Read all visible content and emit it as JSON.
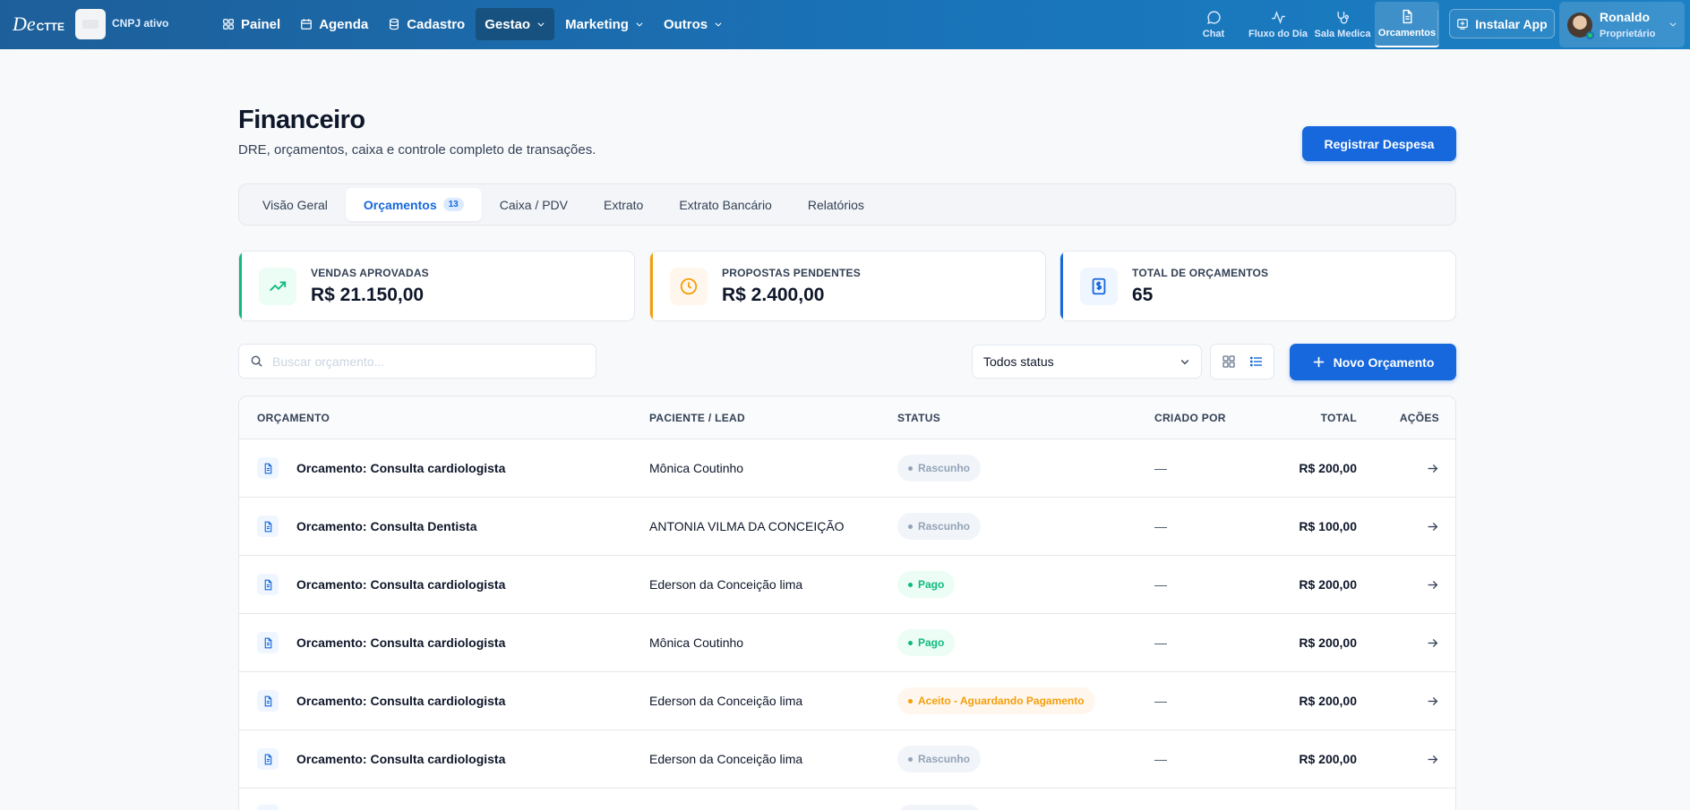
{
  "topbar": {
    "logo_main": "De",
    "logo_small": "CTTE",
    "cnpj_label": "CNPJ ativo",
    "nav": [
      {
        "label": "Painel",
        "icon": "grid-icon"
      },
      {
        "label": "Agenda",
        "icon": "calendar-icon"
      },
      {
        "label": "Cadastro",
        "icon": "database-icon"
      },
      {
        "label": "Gestao",
        "icon": "chevron-down-icon"
      },
      {
        "label": "Marketing",
        "icon": "chevron-down-icon"
      },
      {
        "label": "Outros",
        "icon": "chevron-down-icon"
      }
    ],
    "quick": [
      {
        "label": "Chat",
        "icon": "chat-icon"
      },
      {
        "label": "Fluxo do Dia",
        "icon": "activity-icon"
      },
      {
        "label": "Sala Medica",
        "icon": "stethoscope-icon"
      },
      {
        "label": "Orcamentos",
        "icon": "document-icon"
      }
    ],
    "install_label": "Instalar App",
    "user": {
      "name": "Ronaldo",
      "role": "Proprietário"
    }
  },
  "page": {
    "title": "Financeiro",
    "subtitle": "DRE, orçamentos, caixa e controle completo de transações.",
    "register_button": "Registrar Despesa"
  },
  "tabs": [
    {
      "label": "Visão Geral"
    },
    {
      "label": "Orçamentos",
      "count": "13"
    },
    {
      "label": "Caixa / PDV"
    },
    {
      "label": "Extrato"
    },
    {
      "label": "Extrato Bancário"
    },
    {
      "label": "Relatórios"
    }
  ],
  "stats": [
    {
      "label": "VENDAS APROVADAS",
      "value": "R$ 21.150,00",
      "color": "#10b981"
    },
    {
      "label": "PROPOSTAS PENDENTES",
      "value": "R$ 2.400,00",
      "color": "#f59e0b"
    },
    {
      "label": "TOTAL DE ORÇAMENTOS",
      "value": "65",
      "color": "#1668dc"
    }
  ],
  "toolbar": {
    "search_placeholder": "Buscar orçamento...",
    "status_selected": "Todos status",
    "new_button": "Novo Orçamento"
  },
  "table": {
    "headers": {
      "budget": "ORÇAMENTO",
      "patient": "PACIENTE / LEAD",
      "status": "STATUS",
      "created_by": "CRIADO POR",
      "total": "TOTAL",
      "actions": "AÇÕES"
    },
    "rows": [
      {
        "name": "Orcamento: Consulta cardiologista",
        "patient": "Mônica Coutinho",
        "status": "Rascunho",
        "status_kind": "gray",
        "created_by": "—",
        "total": "R$ 200,00"
      },
      {
        "name": "Orcamento: Consulta Dentista",
        "patient": "ANTONIA VILMA DA CONCEIÇÃO",
        "status": "Rascunho",
        "status_kind": "gray",
        "created_by": "—",
        "total": "R$ 100,00"
      },
      {
        "name": "Orcamento: Consulta cardiologista",
        "patient": "Ederson da Conceição lima",
        "status": "Pago",
        "status_kind": "green",
        "created_by": "—",
        "total": "R$ 200,00"
      },
      {
        "name": "Orcamento: Consulta cardiologista",
        "patient": "Mônica Coutinho",
        "status": "Pago",
        "status_kind": "green",
        "created_by": "—",
        "total": "R$ 200,00"
      },
      {
        "name": "Orcamento: Consulta cardiologista",
        "patient": "Ederson da Conceição lima",
        "status": "Aceito - Aguardando Pagamento",
        "status_kind": "orange",
        "created_by": "—",
        "total": "R$ 200,00"
      },
      {
        "name": "Orcamento: Consulta cardiologista",
        "patient": "Ederson da Conceição lima",
        "status": "Rascunho",
        "status_kind": "gray",
        "created_by": "—",
        "total": "R$ 200,00"
      }
    ]
  }
}
